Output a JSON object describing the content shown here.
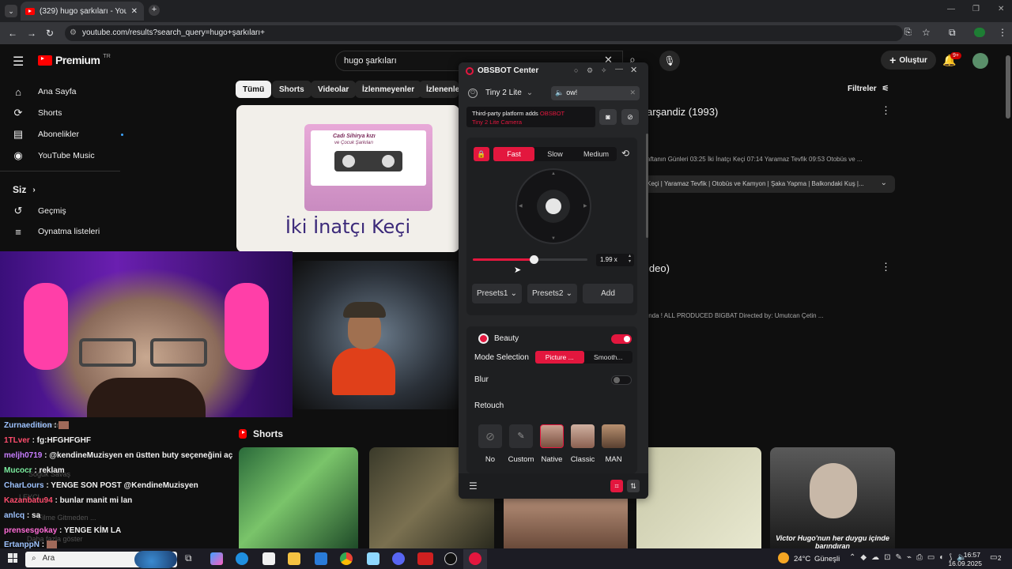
{
  "browser": {
    "tab_title": "(329) hugo şarkıları - YouTube",
    "url": "youtube.com/results?search_query=hugo+şarkıları+"
  },
  "youtube": {
    "logo_text": "Premium",
    "logo_region": "TR",
    "search_value": "hugo şarkıları",
    "create_label": "Oluştur",
    "notif_badge": "9+",
    "filters_label": "Filtreler",
    "sidebar": {
      "items": [
        {
          "label": "Ana Sayfa",
          "icon": "home-icon"
        },
        {
          "label": "Shorts",
          "icon": "shorts-icon"
        },
        {
          "label": "Abonelikler",
          "icon": "subscriptions-icon"
        },
        {
          "label": "YouTube Music",
          "icon": "music-icon"
        }
      ],
      "you_label": "Siz",
      "you_items": [
        {
          "label": "Geçmiş",
          "icon": "history-icon"
        },
        {
          "label": "Oynatma listeleri",
          "icon": "playlist-icon"
        }
      ]
    },
    "chips": [
      "Tümü",
      "Shorts",
      "Videolar",
      "İzlenmeyenler",
      "İzlenenler"
    ],
    "results": [
      {
        "title_fragment": "arşandiz (1993)",
        "desc": "aftanın Günleri 03:25 İki İnatçı Keçi 07:14 Yaramaz Tevfik 09:53 Otobüs ve ...",
        "chapters": "Keçi | Yaramaz Tevfik | Otobüs ve Kamyon | Şaka Yapma | Balkondaki Kuş |...",
        "thumb_text": "İki İnatçı Keçi",
        "cassette_label_1": "Cadı Sihirya kızı",
        "cassette_label_2": "ve Çocuk Şarkıları"
      },
      {
        "title_fragment": "ideo)",
        "desc": "ında ! ALL PRODUCED BIGBAT Directed by: Umutcan Çetin ..."
      }
    ],
    "shorts_heading": "Shorts",
    "short_caption": "Victor Hugo'nun her duygu içinde barındıran"
  },
  "chat": {
    "lines": [
      {
        "user": "Zurnaedition",
        "msg": ":",
        "color": "#9ec3ff"
      },
      {
        "user": "1TLver",
        "msg": ": fg:HFGHFGHF",
        "color": "#ff4d6d"
      },
      {
        "user": "meljh0719",
        "msg": ": @kendineMuzisyen en üstten buty seçeneğini aç",
        "color": "#c77dff"
      },
      {
        "user": "Mucocr",
        "msg": ": reklam",
        "color": "#7bed9f"
      },
      {
        "user": "CharLours",
        "msg": ": YENGE SON POST @KendineMuzisyen",
        "color": "#9ec3ff"
      },
      {
        "user": "Kazanbatu94",
        "msg": ": bunlar manit mi lan",
        "color": "#ff4d6d"
      },
      {
        "user": "anlcq",
        "msg": ": sa",
        "color": "#9ec3ff"
      },
      {
        "user": "prensesgokay",
        "msg": ": YENGE KİM LA",
        "color": "#ff6bd6"
      },
      {
        "user": "ErtanppN",
        "msg": ":",
        "color": "#9ec3ff"
      }
    ],
    "ghost": [
      "kleanin",
      "Soğuk Savaş",
      "LEYCI",
      "Filme Gitmeden ...",
      "Daha fazla göster"
    ]
  },
  "obsbot": {
    "title": "OBSBOT Center",
    "device": "Tiny 2 Lite",
    "notice_field": "ow!",
    "banner_line1": "Third-party platform adds ",
    "banner_brand": "OBSBOT",
    "banner_line2": "Tiny 2 Lite Camera",
    "speed_modes": [
      "Fast",
      "Slow",
      "Medium"
    ],
    "speed_selected": "Fast",
    "zoom_value": "1.99 x",
    "zoom_fraction": 0.2,
    "preset1": "Presets1",
    "preset2": "Presets2",
    "add_label": "Add",
    "beauty_label": "Beauty",
    "beauty_on": true,
    "mode_selection_label": "Mode Selection",
    "modes": [
      "Picture ...",
      "Smooth..."
    ],
    "mode_selected": "Picture ...",
    "blur_label": "Blur",
    "blur_on": false,
    "retouch_label": "Retouch",
    "retouch_options": [
      "No",
      "Custom",
      "Native",
      "Classic",
      "MAN"
    ],
    "retouch_selected": "Native"
  },
  "taskbar": {
    "search_placeholder": "Ara",
    "weather": "24°C",
    "weather_desc": "Güneşli",
    "time": "16:57",
    "date": "16.09.2025",
    "notif_count": "2"
  },
  "colors": {
    "accent": "#e3173e",
    "yt_red": "#ff0000"
  }
}
